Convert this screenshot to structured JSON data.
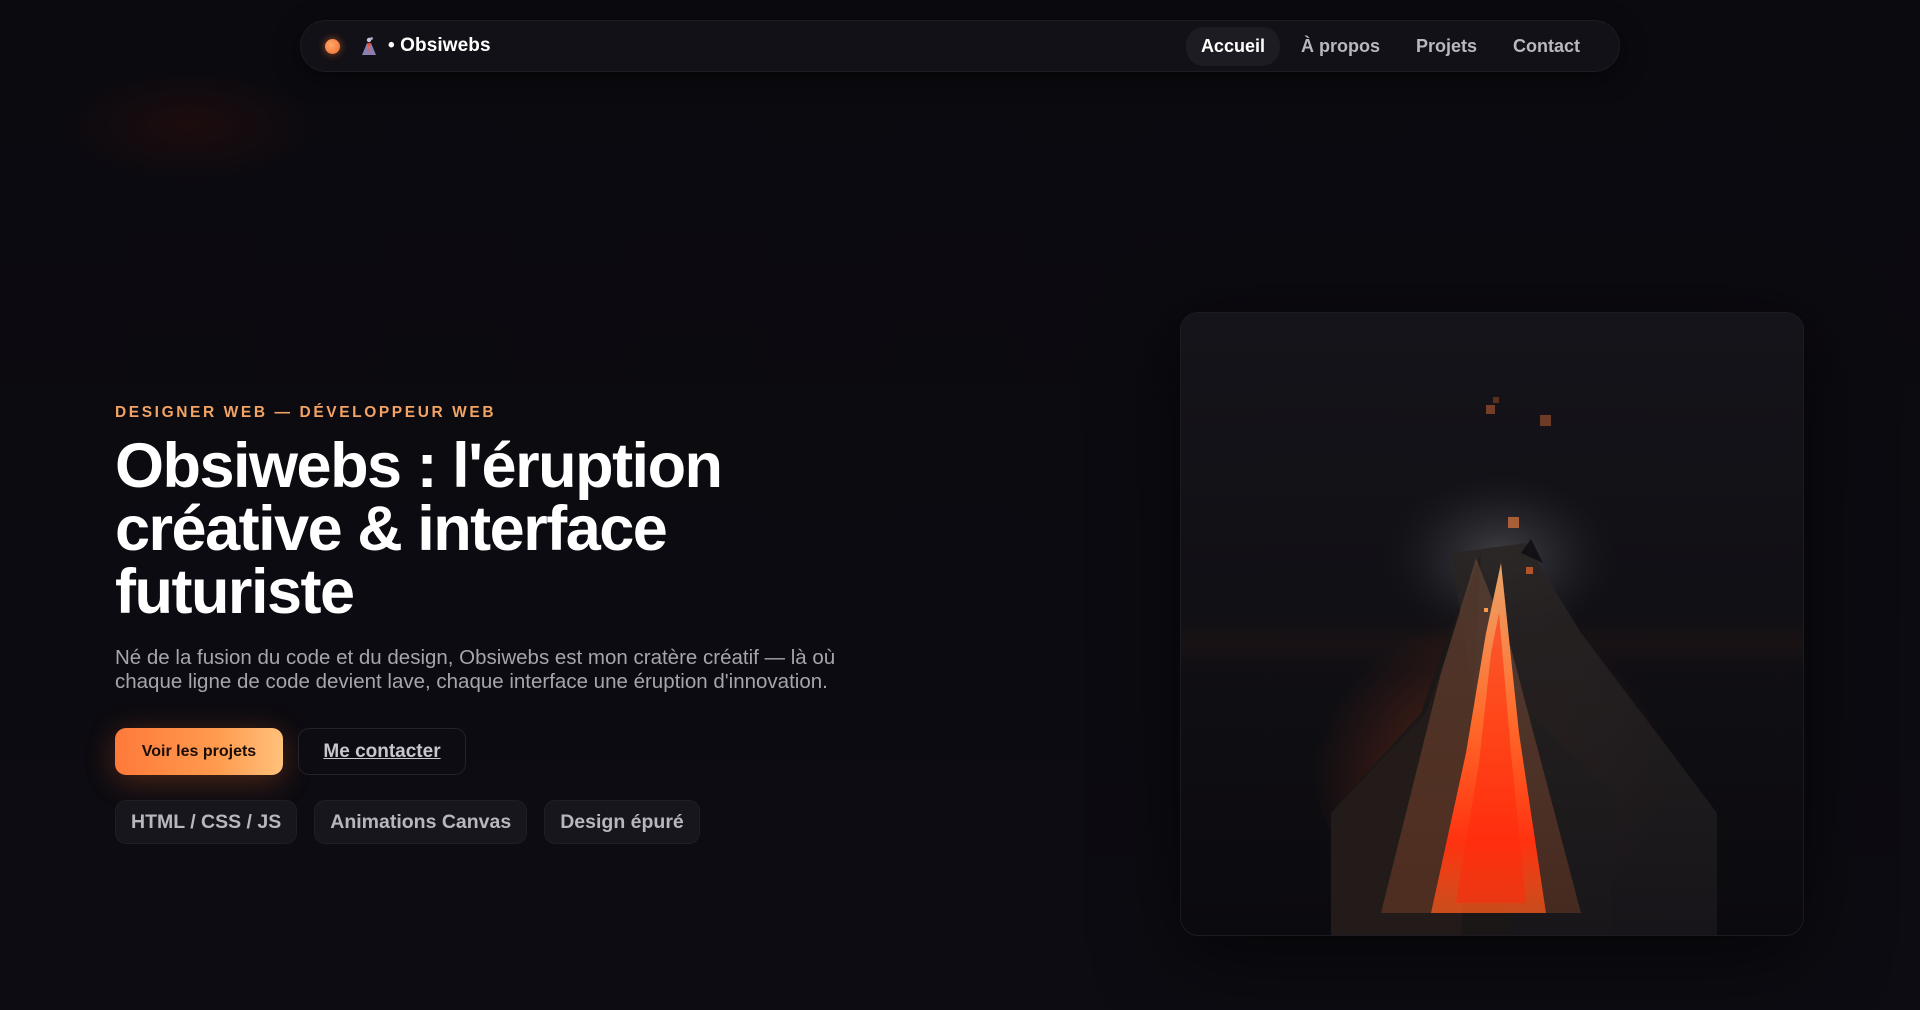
{
  "nav": {
    "brand": "• Obsiwebs",
    "brand_icon": "volcano-icon",
    "status_dot_color": "#f47a3a",
    "links": [
      {
        "label": "Accueil",
        "active": true
      },
      {
        "label": "À propos",
        "active": false
      },
      {
        "label": "Projets",
        "active": false
      },
      {
        "label": "Contact",
        "active": false
      }
    ]
  },
  "hero": {
    "eyebrow": "DESIGNER WEB — DÉVELOPPEUR WEB",
    "title": "Obsiwebs : l'éruption créative & interface futuriste",
    "lead": "Né de la fusion du code et du design, Obsiwebs est mon cratère créatif — là où chaque ligne de code devient lave, chaque interface une éruption d'innovation.",
    "primary_button": "Voir les projets",
    "secondary_button": "Me contacter",
    "tags": [
      "HTML / CSS / JS",
      "Animations Canvas",
      "Design épuré"
    ]
  },
  "colors": {
    "accent": "#ff8a45",
    "accent_light": "#ffc17a",
    "eyebrow": "#f3a363",
    "background": "#0b0a0f",
    "lava": "#ff3a12"
  }
}
